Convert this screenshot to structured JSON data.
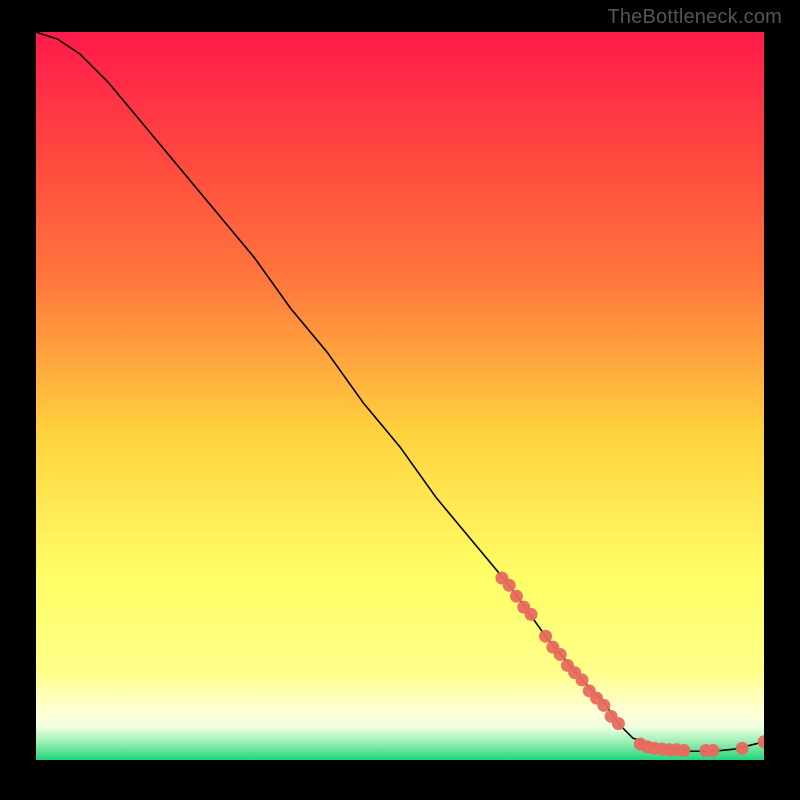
{
  "watermark": "TheBottleneck.com",
  "chart_data": {
    "type": "line",
    "title": "",
    "xlabel": "",
    "ylabel": "",
    "xlim": [
      0,
      100
    ],
    "ylim": [
      0,
      100
    ],
    "colors": {
      "gradient_top": "#ff1a4b",
      "gradient_mid_upper": "#ff7a3c",
      "gradient_mid": "#ffd23f",
      "gradient_lower": "#ffff8a",
      "gradient_bottom_pale": "#f0ffe0",
      "gradient_bottom": "#1fd67a",
      "line_main": "#000000",
      "marker": "#e86a5e"
    },
    "main_curve": {
      "name": "bottleneck-curve",
      "x": [
        0,
        3,
        6,
        10,
        15,
        20,
        25,
        30,
        35,
        40,
        45,
        50,
        55,
        60,
        65,
        70,
        75,
        78,
        80,
        82,
        85,
        88,
        90,
        92,
        94,
        96,
        100
      ],
      "y": [
        100,
        99,
        97,
        93,
        87,
        81,
        75,
        69,
        62,
        56,
        49,
        43,
        36,
        30,
        24,
        17,
        11,
        8,
        5,
        3,
        2,
        1.5,
        1.2,
        1.2,
        1.3,
        1.5,
        2.5
      ]
    },
    "markers": {
      "name": "highlighted-points",
      "points": [
        {
          "x": 64,
          "y": 25
        },
        {
          "x": 65,
          "y": 24
        },
        {
          "x": 66,
          "y": 22.5
        },
        {
          "x": 67,
          "y": 21
        },
        {
          "x": 68,
          "y": 20
        },
        {
          "x": 70,
          "y": 17
        },
        {
          "x": 71,
          "y": 15.5
        },
        {
          "x": 72,
          "y": 14.5
        },
        {
          "x": 73,
          "y": 13
        },
        {
          "x": 74,
          "y": 12
        },
        {
          "x": 75,
          "y": 11
        },
        {
          "x": 76,
          "y": 9.5
        },
        {
          "x": 77,
          "y": 8.5
        },
        {
          "x": 78,
          "y": 7.5
        },
        {
          "x": 79,
          "y": 6
        },
        {
          "x": 80,
          "y": 5
        },
        {
          "x": 83,
          "y": 2.2
        },
        {
          "x": 84,
          "y": 1.8
        },
        {
          "x": 85,
          "y": 1.6
        },
        {
          "x": 86,
          "y": 1.5
        },
        {
          "x": 87,
          "y": 1.4
        },
        {
          "x": 88,
          "y": 1.4
        },
        {
          "x": 89,
          "y": 1.3
        },
        {
          "x": 92,
          "y": 1.3
        },
        {
          "x": 93,
          "y": 1.3
        },
        {
          "x": 97,
          "y": 1.6
        },
        {
          "x": 100,
          "y": 2.5
        }
      ]
    }
  }
}
